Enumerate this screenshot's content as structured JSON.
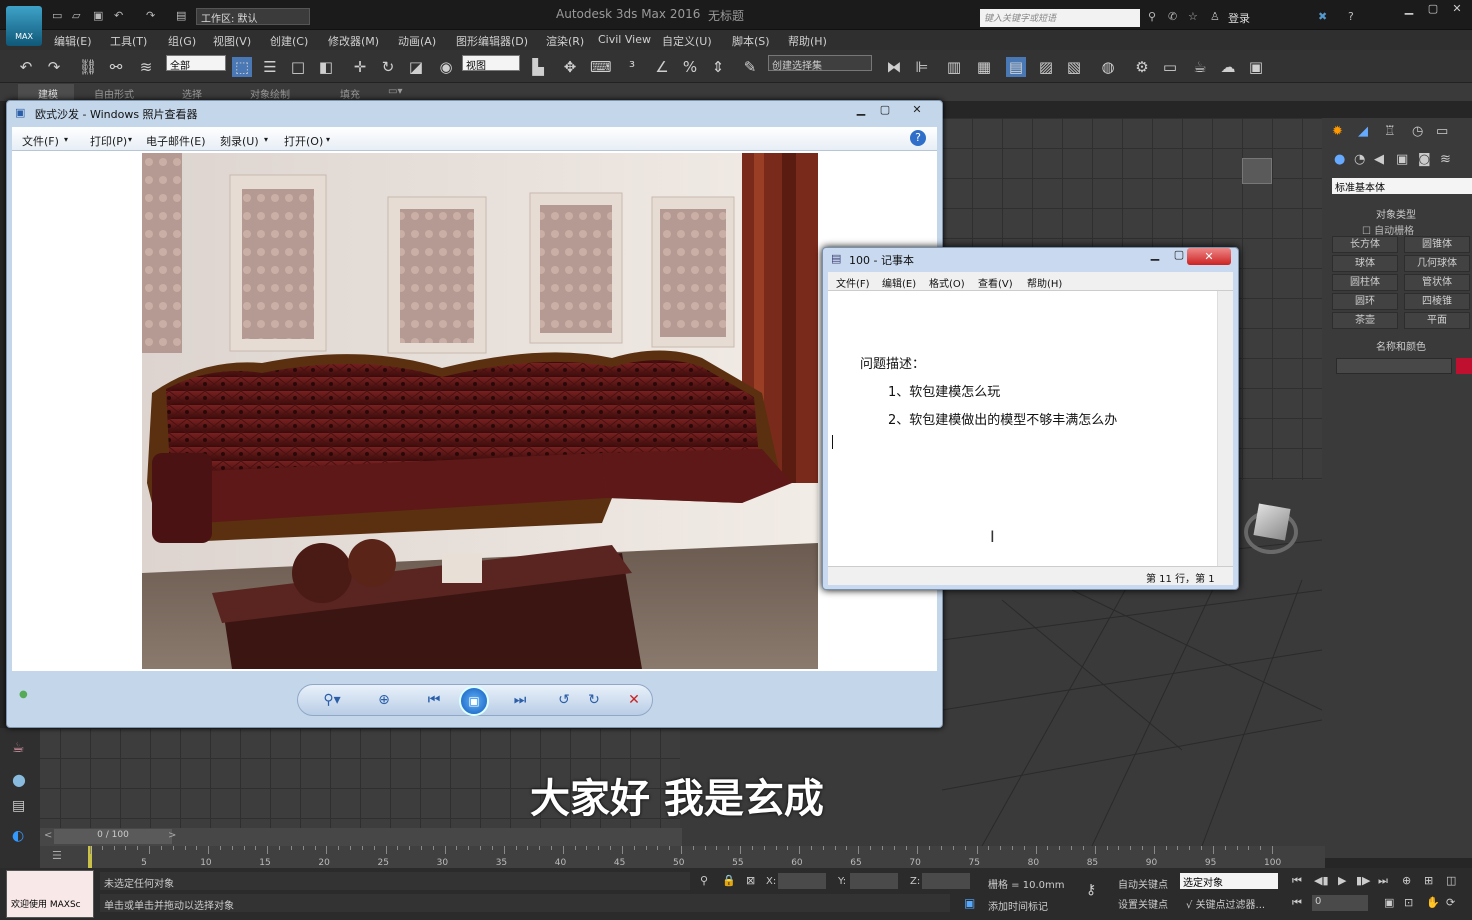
{
  "app": {
    "title": "Autodesk 3ds Max 2016",
    "untitled": "无标题",
    "workspace_label": "工作区: 默认",
    "search_placeholder": "键入关键字或短语",
    "login": "登录",
    "logo_text": "MAX"
  },
  "menubar": {
    "items": [
      "编辑(E)",
      "工具(T)",
      "组(G)",
      "视图(V)",
      "创建(C)",
      "修改器(M)",
      "动画(A)",
      "图形编辑器(D)",
      "渲染(R)",
      "Civil View",
      "自定义(U)",
      "脚本(S)",
      "帮助(H)"
    ]
  },
  "toolbar": {
    "filter_value": "全部",
    "refcoord_value": "视图",
    "named_sel_value": "创建选择集"
  },
  "ribbon": {
    "tabs": [
      "建模",
      "自由形式",
      "选择",
      "对象绘制",
      "填充"
    ]
  },
  "photo_viewer": {
    "title": "欧式沙发 - Windows 照片查看器",
    "menu": [
      "文件(F)",
      "打印(P)",
      "电子邮件(E)",
      "刻录(U)",
      "打开(O)"
    ],
    "help_icon": "help-icon"
  },
  "notepad": {
    "title": "100 - 记事本",
    "menu": [
      "文件(F)",
      "编辑(E)",
      "格式(O)",
      "查看(V)",
      "帮助(H)"
    ],
    "lines": [
      "问题描述：",
      "1、软包建模怎么玩",
      "2、软包建模做出的模型不够丰满怎么办"
    ],
    "status": "第 11 行，第 1"
  },
  "command_panel": {
    "dropdown": "标准基本体",
    "section_object_type": "对象类型",
    "autogrid": "自动栅格",
    "buttons": [
      [
        "长方体",
        "圆锥体"
      ],
      [
        "球体",
        "几何球体"
      ],
      [
        "圆柱体",
        "管状体"
      ],
      [
        "圆环",
        "四棱锥"
      ],
      [
        "茶壶",
        "平面"
      ]
    ],
    "section_name_color": "名称和颜色",
    "color_swatch": "#c01030"
  },
  "timeline": {
    "frame_label": "0 / 100",
    "ticks": [
      "5",
      "10",
      "15",
      "20",
      "25",
      "30",
      "35",
      "40",
      "45",
      "50",
      "55",
      "60",
      "65",
      "70",
      "75",
      "80",
      "85",
      "90",
      "95",
      "100"
    ]
  },
  "statusbar": {
    "welcome": "欢迎使用 MAXSc",
    "line1": "未选定任何对象",
    "line2": "单击或单击并拖动以选择对象",
    "x_label": "X:",
    "y_label": "Y:",
    "z_label": "Z:",
    "grid": "栅格 = 10.0mm",
    "auto_key": "自动关键点",
    "set_key": "设置关键点",
    "sel_dropdown": "选定对象",
    "key_filter": "关键点过滤器...",
    "add_time_tag": "添加时间标记",
    "frame_value": "0"
  },
  "subtitle": "大家好  我是玄成"
}
